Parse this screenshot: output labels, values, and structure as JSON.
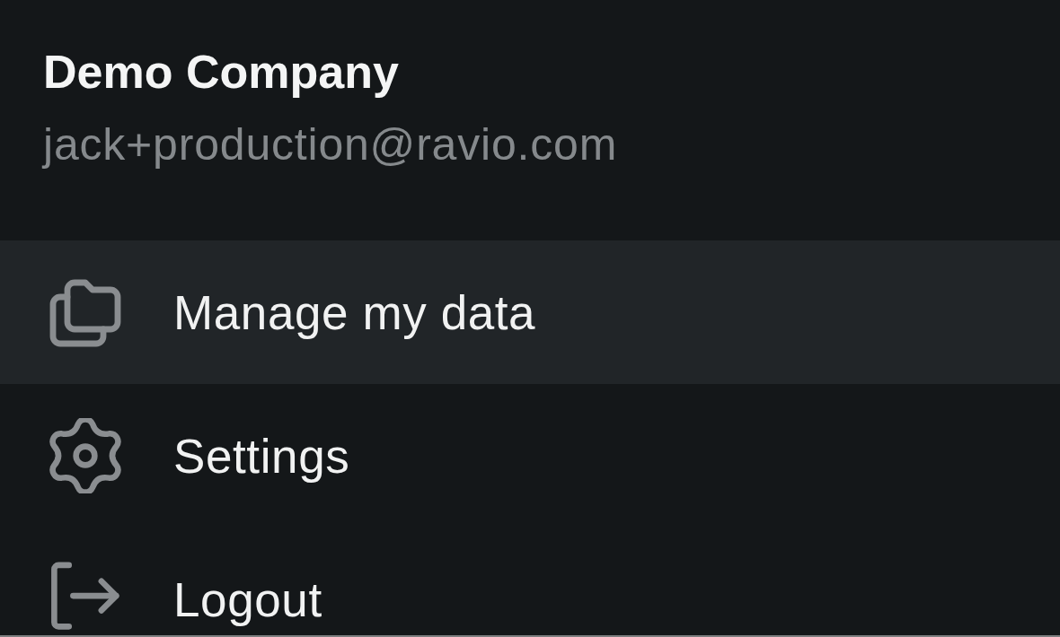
{
  "account": {
    "company": "Demo Company",
    "email": "jack+production@ravio.com"
  },
  "menu": [
    {
      "label": "Manage my data",
      "highlighted": true
    },
    {
      "label": "Settings",
      "highlighted": false
    },
    {
      "label": "Logout",
      "highlighted": false
    }
  ]
}
